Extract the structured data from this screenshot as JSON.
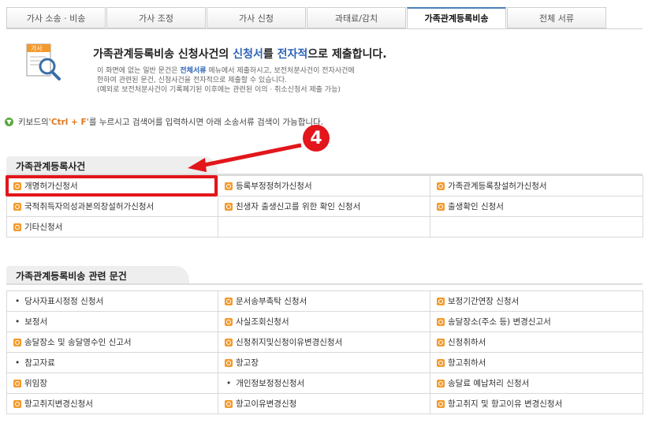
{
  "tabs": [
    "가사 소송 · 비송",
    "가사 조정",
    "가사 신청",
    "과태료/감치",
    "가족관계등록비송",
    "전체 서류"
  ],
  "active_tab": 4,
  "intro": {
    "icon_label": "가사",
    "title_pre": "가족관계등록비송 신청사건의 ",
    "title_hl1": "신청서",
    "title_mid": "를 ",
    "title_hl2": "전자적",
    "title_post": "으로 제출합니다.",
    "desc_line1_pre": "이 화면에 없는 일반 문건은 ",
    "desc_line1_link": "전체서류",
    "desc_line1_post": " 메뉴에서 제출하시고, 보전처분사건이 전자사건에",
    "desc_line2": "한하여 관련된 문건, 신청사건을 전자적으로 제출할 수 있습니다.",
    "desc_line3": "(예외로 보전처분사건이 기록폐기된 이후에는 관련된 이의 · 취소신청서 제출 가능)"
  },
  "search_hint": {
    "pre": " 키보드의 ",
    "key": "'Ctrl + F'",
    "post": "를 누르시고 검색어를 입력하시면 아래 소송서류 검색이 가능합니다."
  },
  "annotation_number": "4",
  "section1": {
    "title": "가족관계등록사건",
    "rows": [
      [
        {
          "icon": "doc",
          "label": "개명허가신청서"
        },
        {
          "icon": "doc",
          "label": "등록부정정허가신청서"
        },
        {
          "icon": "doc",
          "label": "가족관계등록창설허가신청서"
        }
      ],
      [
        {
          "icon": "doc",
          "label": "국적취득자의성과본의창설허가신청서"
        },
        {
          "icon": "doc",
          "label": "친생자 출생신고를 위한 확인 신청서"
        },
        {
          "icon": "doc",
          "label": "출생확인 신청서"
        }
      ],
      [
        {
          "icon": "doc",
          "label": "기타신청서"
        },
        {
          "icon": "none",
          "label": ""
        },
        {
          "icon": "none",
          "label": ""
        }
      ]
    ]
  },
  "section2": {
    "title": "가족관계등록비송 관련 문건",
    "rows": [
      [
        {
          "icon": "bullet",
          "label": "당사자표시정정 신청서"
        },
        {
          "icon": "doc",
          "label": "문서송부촉탁 신청서"
        },
        {
          "icon": "doc",
          "label": "보정기간연장 신청서"
        }
      ],
      [
        {
          "icon": "bullet",
          "label": "보정서"
        },
        {
          "icon": "doc",
          "label": "사실조회신청서"
        },
        {
          "icon": "doc",
          "label": "송달장소(주소 등) 변경신고서"
        }
      ],
      [
        {
          "icon": "doc",
          "label": "송달장소 및 송달영수인 신고서"
        },
        {
          "icon": "doc",
          "label": "신청취지및신청이유변경신청서"
        },
        {
          "icon": "doc",
          "label": "신청취하서"
        }
      ],
      [
        {
          "icon": "bullet",
          "label": "참고자료"
        },
        {
          "icon": "doc",
          "label": "항고장"
        },
        {
          "icon": "doc",
          "label": "항고취하서"
        }
      ],
      [
        {
          "icon": "doc",
          "label": "위임장"
        },
        {
          "icon": "bullet",
          "label": "개인정보정정신청서"
        },
        {
          "icon": "doc",
          "label": "송달료 예납처리 신청서"
        }
      ],
      [
        {
          "icon": "doc",
          "label": "항고취지변경신청서"
        },
        {
          "icon": "doc",
          "label": "항고이유변경신청"
        },
        {
          "icon": "doc",
          "label": "항고취지 및 항고이유 변경신청서"
        }
      ]
    ]
  },
  "colors": {
    "accent": "#2c63b7",
    "highlight": "#e2161b",
    "doc_icon": "#f39a2d",
    "key_text": "#e0781f"
  }
}
